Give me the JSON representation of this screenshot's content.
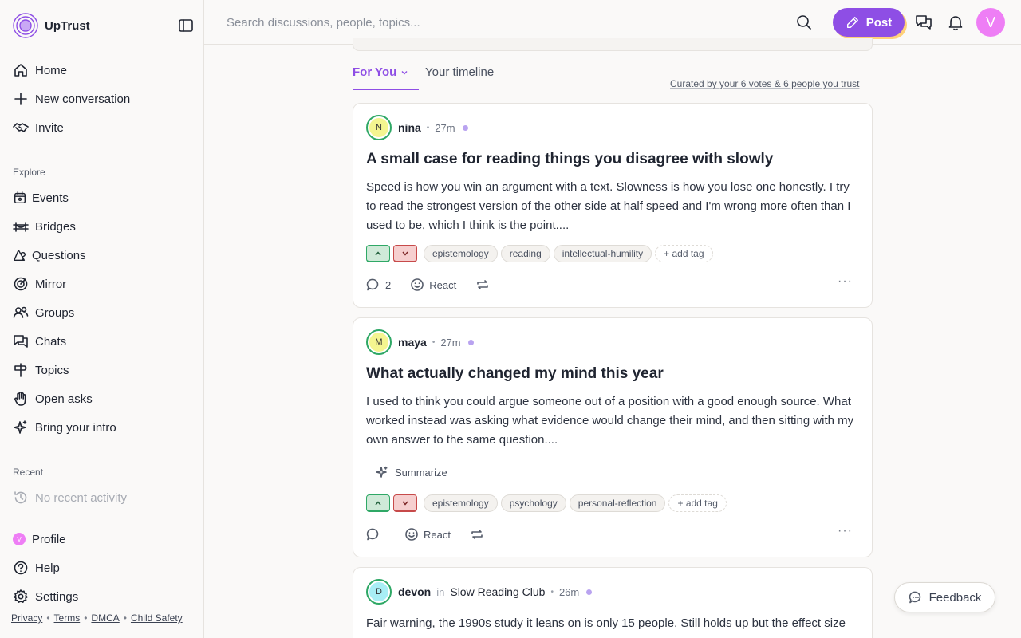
{
  "app": {
    "name": "UpTrust"
  },
  "nav": {
    "main": [
      {
        "label": "Home",
        "icon": "home-icon"
      },
      {
        "label": "New conversation",
        "icon": "plus-icon"
      },
      {
        "label": "Invite",
        "icon": "handshake-icon"
      }
    ],
    "explore_label": "Explore",
    "explore": [
      {
        "label": "Events",
        "icon": "calendar-icon"
      },
      {
        "label": "Bridges",
        "icon": "bridge-icon"
      },
      {
        "label": "Questions",
        "icon": "question-icon"
      },
      {
        "label": "Mirror",
        "icon": "target-icon"
      },
      {
        "label": "Groups",
        "icon": "users-icon"
      },
      {
        "label": "Chats",
        "icon": "chat-icon"
      },
      {
        "label": "Topics",
        "icon": "signpost-icon"
      },
      {
        "label": "Open asks",
        "icon": "hand-icon"
      },
      {
        "label": "Bring your intro",
        "icon": "sparkle-icon"
      }
    ],
    "recent_label": "Recent",
    "recent_empty": "No recent activity",
    "bottom": [
      {
        "label": "Profile",
        "icon": "avatar-icon",
        "avatar_letter": "V"
      },
      {
        "label": "Help",
        "icon": "help-icon"
      },
      {
        "label": "Settings",
        "icon": "gear-icon"
      }
    ],
    "footer_links": [
      "Privacy",
      "Terms",
      "DMCA",
      "Child Safety"
    ]
  },
  "topbar": {
    "search_placeholder": "Search discussions, people, topics...",
    "post_label": "Post",
    "avatar_letter": "V"
  },
  "feed": {
    "tabs": [
      {
        "label": "For You",
        "active": true
      },
      {
        "label": "Your timeline",
        "active": false
      }
    ],
    "curated_note": "Curated by your 6 votes & 6 people you trust",
    "posts": [
      {
        "author": "nina",
        "avatar_letter": "N",
        "avatar_color": "#f4f590",
        "time": "27m",
        "title": "A small case for reading things you disagree with slowly",
        "body": "Speed is how you win an argument with a text. Slowness is how you lose one honestly. I try to read the strongest version of the other side at half speed and I'm wrong more often than I used to be, which I think is the point....",
        "tags": [
          "epistemology",
          "reading",
          "intellectual-humility"
        ],
        "add_tag_label": "+ add tag",
        "comment_count": "2",
        "react_label": "React"
      },
      {
        "author": "maya",
        "avatar_letter": "M",
        "avatar_color": "#f4f590",
        "time": "27m",
        "title": "What actually changed my mind this year",
        "body": "I used to think you could argue someone out of a position with a good enough source. What worked instead was asking what evidence would change their mind, and then sitting with my own answer to the same question....",
        "summarize_label": "Summarize",
        "tags": [
          "epistemology",
          "psychology",
          "personal-reflection"
        ],
        "add_tag_label": "+ add tag",
        "react_label": "React"
      },
      {
        "author": "devon",
        "avatar_letter": "D",
        "avatar_color": "#a8eef5",
        "in_word": "in",
        "group": "Slow Reading Club",
        "time": "26m",
        "body": "Fair warning, the 1990s study it leans on is only 15 people. Still holds up but the effect size"
      }
    ]
  },
  "feedback_label": "Feedback",
  "colors": {
    "accent": "#8e4ee5",
    "upvote": "#2fa866",
    "downvote": "#c74a4a"
  }
}
